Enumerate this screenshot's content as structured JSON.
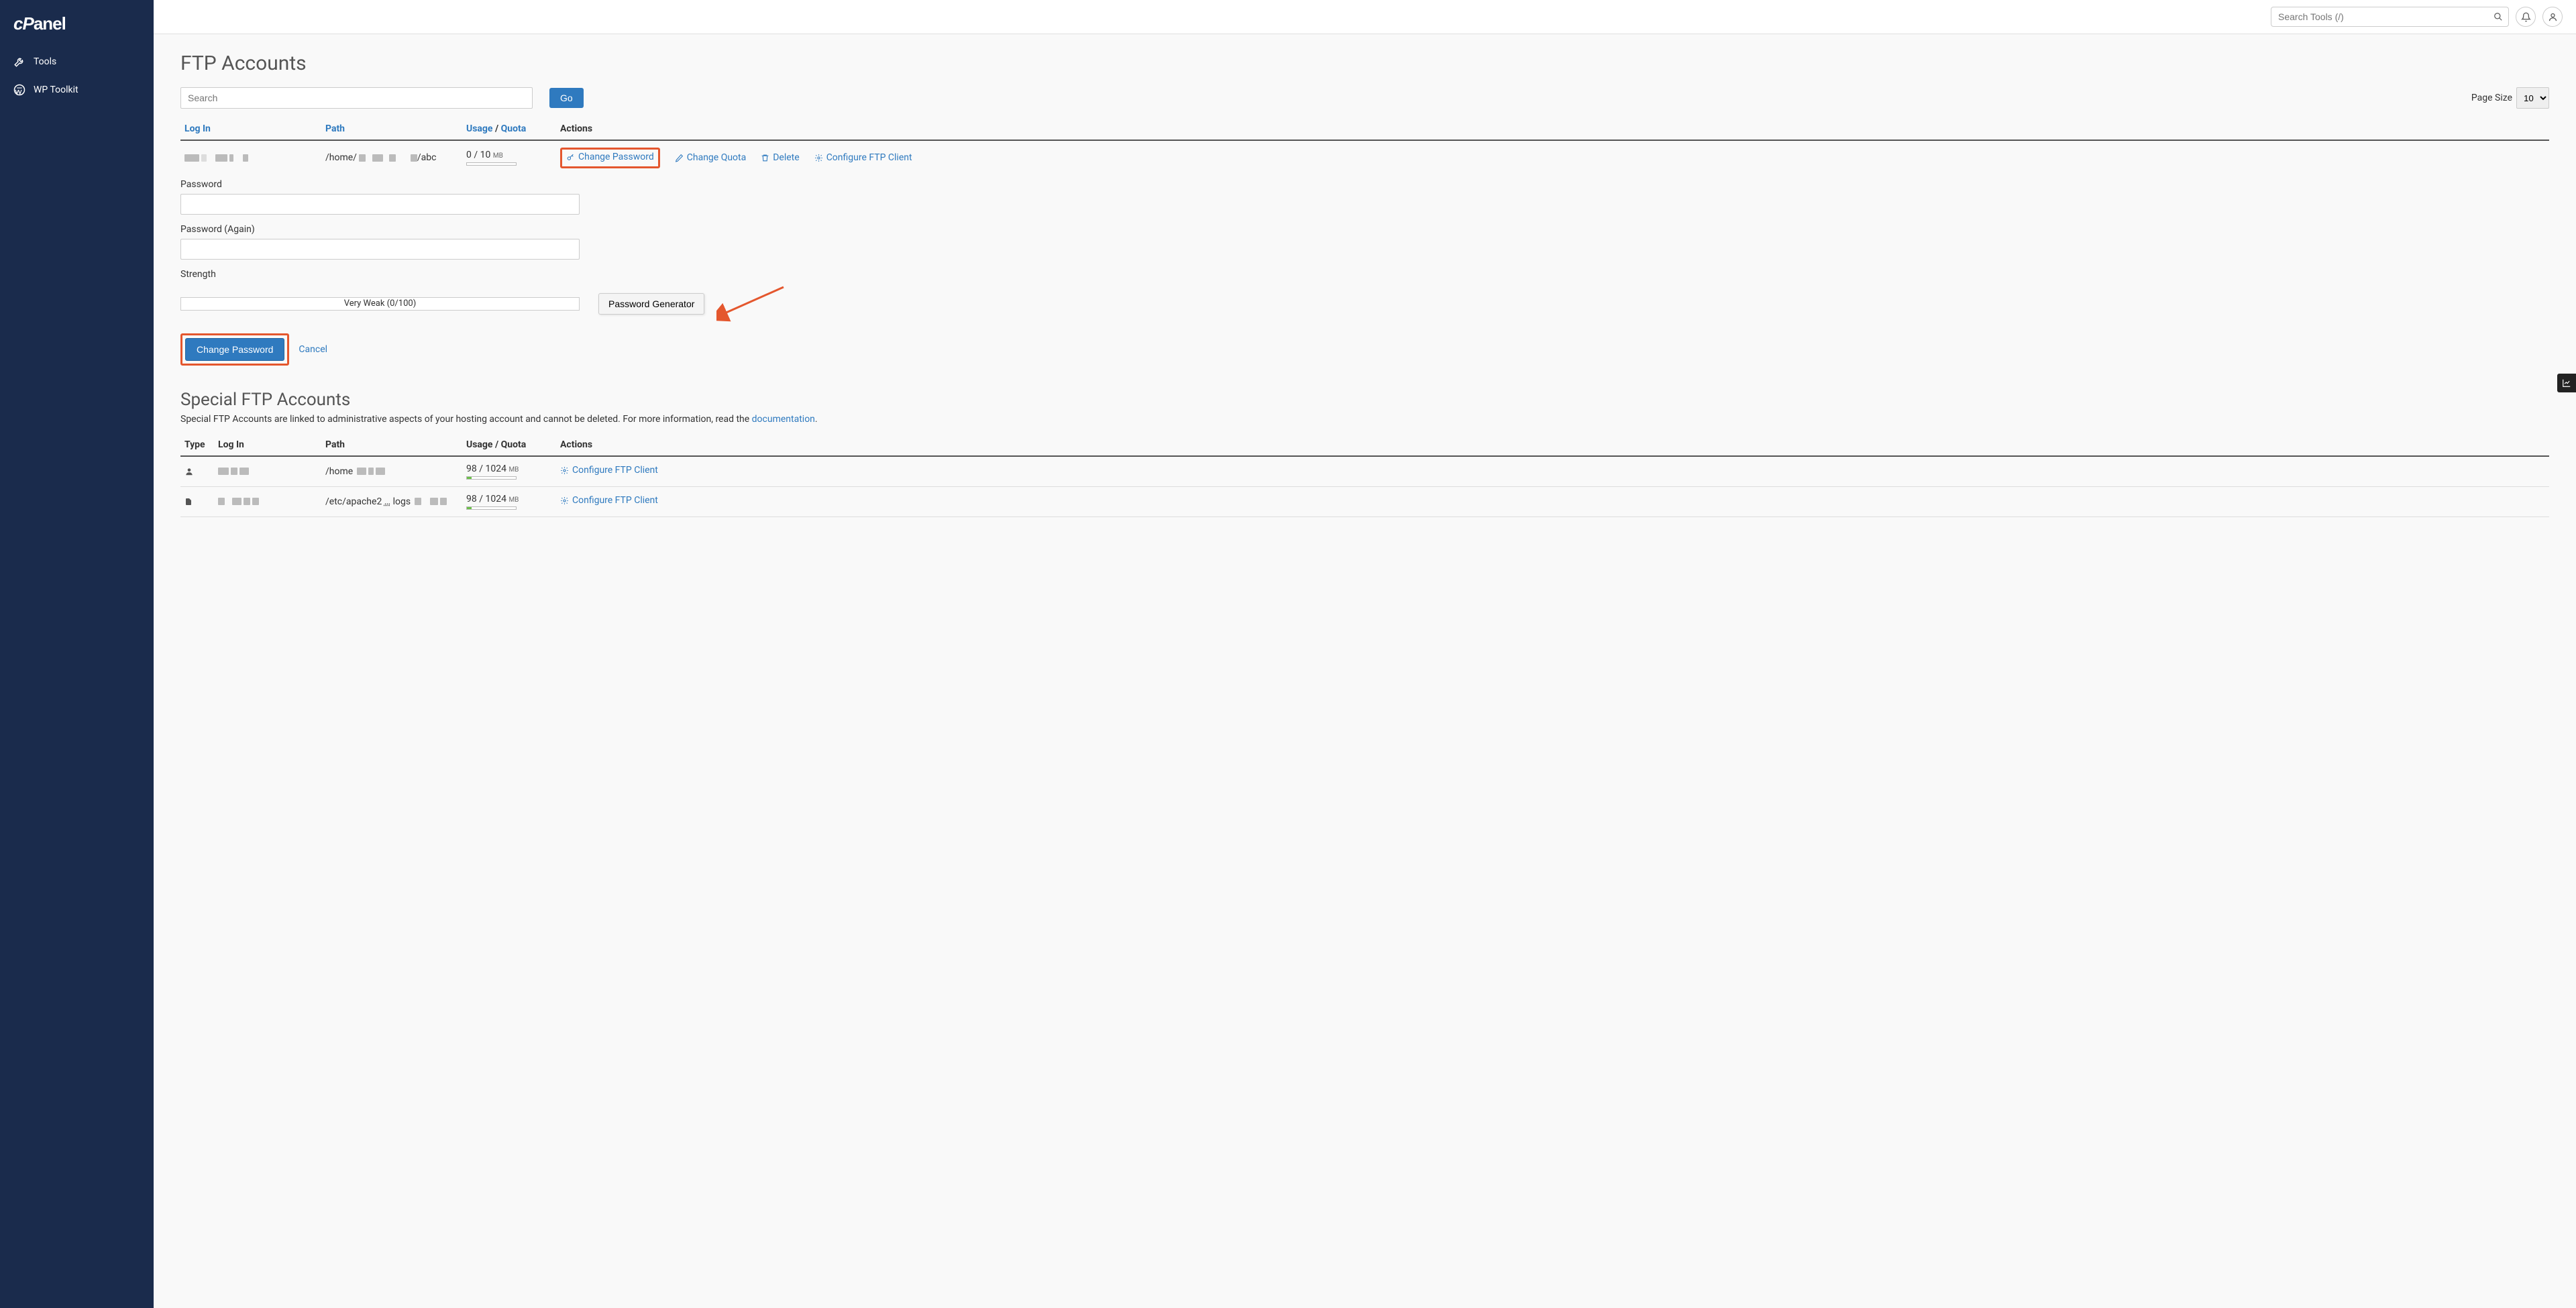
{
  "sidebar": {
    "logo": "cPanel",
    "items": [
      {
        "label": "Tools",
        "icon": "tools-icon"
      },
      {
        "label": "WP Toolkit",
        "icon": "wordpress-icon"
      }
    ]
  },
  "topbar": {
    "search_placeholder": "Search Tools (/)"
  },
  "page": {
    "title": "FTP Accounts",
    "search_placeholder": "Search",
    "go_label": "Go",
    "pagesize_label": "Page Size",
    "pagesize_value": "10"
  },
  "ftptable": {
    "headers": {
      "login": "Log In",
      "path": "Path",
      "usage": "Usage",
      "quota": "Quota",
      "actions": "Actions"
    },
    "rows": [
      {
        "login": "████████",
        "path_prefix": "/home/",
        "path_suffix": "/abc",
        "usage": "0",
        "quota": "10",
        "unit": "MB",
        "usage_pct": 0,
        "actions": {
          "change_password": "Change Password",
          "change_quota": "Change Quota",
          "delete": "Delete",
          "configure": "Configure FTP Client"
        }
      }
    ]
  },
  "pwform": {
    "password_label": "Password",
    "password_again_label": "Password (Again)",
    "strength_label": "Strength",
    "strength_text": "Very Weak (0/100)",
    "pwgen_label": "Password Generator",
    "change_pw_label": "Change Password",
    "cancel_label": "Cancel"
  },
  "special": {
    "title": "Special FTP Accounts",
    "desc_pre": "Special FTP Accounts are linked to administrative aspects of your hosting account and cannot be deleted. For more information, read the ",
    "desc_link": "documentation",
    "desc_post": ".",
    "headers": {
      "type": "Type",
      "login": "Log In",
      "path": "Path",
      "usage": "Usage / Quota",
      "actions": "Actions"
    },
    "rows": [
      {
        "type": "user",
        "login": "████",
        "path_prefix": "/home",
        "usage": "98",
        "quota": "1024",
        "unit": "MB",
        "usage_pct": 9.6,
        "configure": "Configure FTP Client"
      },
      {
        "type": "file",
        "login": "████",
        "path_prefix": "/etc/apache2",
        "path_mid": "…",
        "path_mid2": "logs",
        "usage": "98",
        "quota": "1024",
        "unit": "MB",
        "usage_pct": 9.6,
        "configure": "Configure FTP Client"
      }
    ]
  }
}
